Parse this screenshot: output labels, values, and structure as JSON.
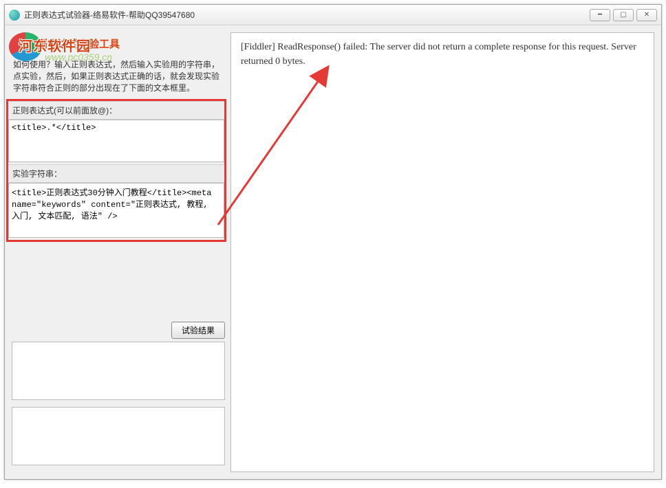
{
  "window": {
    "title": "正则表达式试验器-络易软件-帮助QQ39547680"
  },
  "watermark": {
    "site_name": "河东软件园",
    "url": "www.pc0359.cn"
  },
  "left": {
    "main_title": "正则表达式实验工具",
    "help_text": "如何使用？输入正则表达式，然后输入实验用的字符串，点实验，然后，如果正则表达式正确的话，就会发现实验字符串符合正则的部分出现在了下面的文本框里。",
    "regex_label": "正则表达式(可以前面放@)：",
    "regex_value": "<title>.*</title>",
    "test_label": "实验字符串：",
    "test_value": "<title>正则表达式30分钟入门教程</title><meta name=\"keywords\" content=\"正则表达式, 教程, 入门, 文本匹配, 语法\" />",
    "button_label": "试验结果"
  },
  "right": {
    "response": "[Fiddler] ReadResponse() failed: The server did not return a complete response for this request. Server returned 0 bytes."
  }
}
